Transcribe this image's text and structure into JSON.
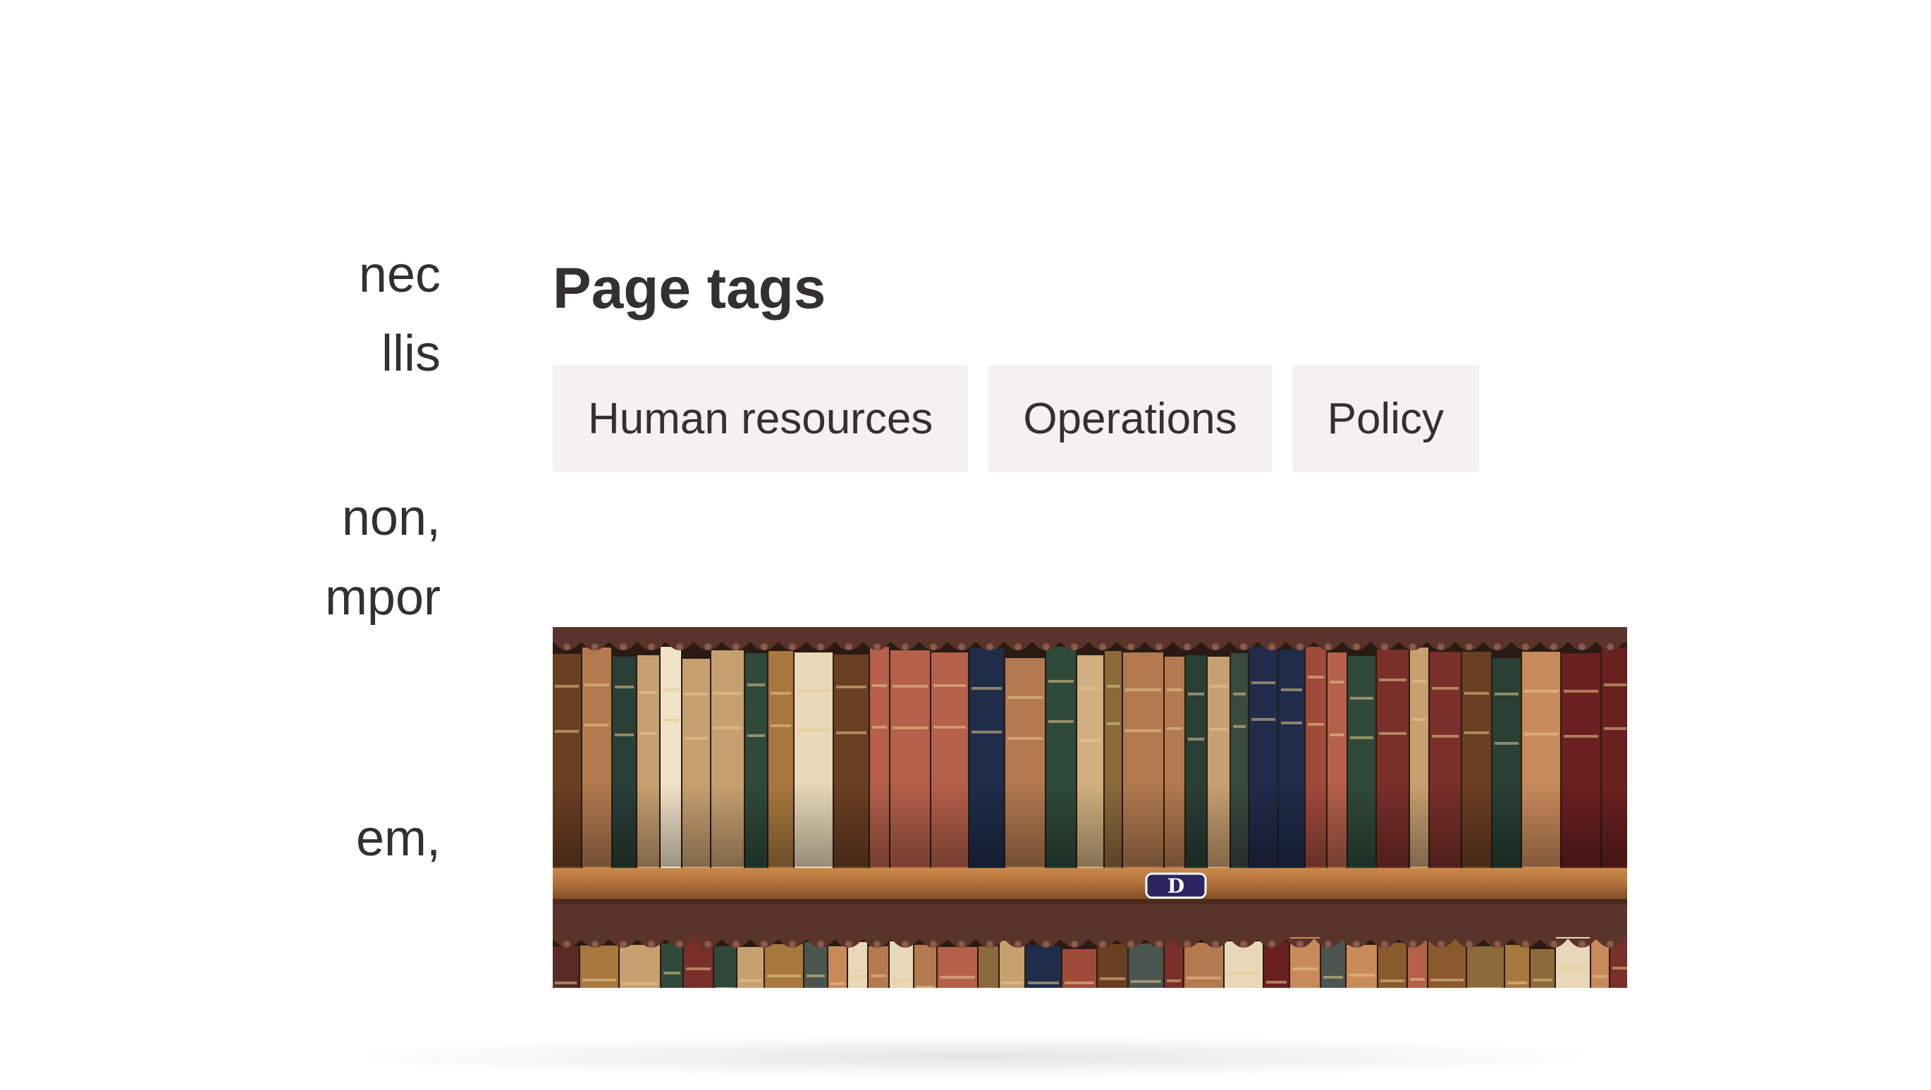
{
  "body_text": {
    "lines": [
      "nec",
      "llis",
      "non,",
      "mpor",
      "em,"
    ]
  },
  "page_tags": {
    "heading": "Page tags",
    "tags": [
      "Human resources",
      "Operations",
      "Policy"
    ]
  },
  "image": {
    "subject": "bookshelf",
    "shelf_label": "D"
  },
  "colors": {
    "text": "#323130",
    "tag_background": "#f3f2f1"
  }
}
